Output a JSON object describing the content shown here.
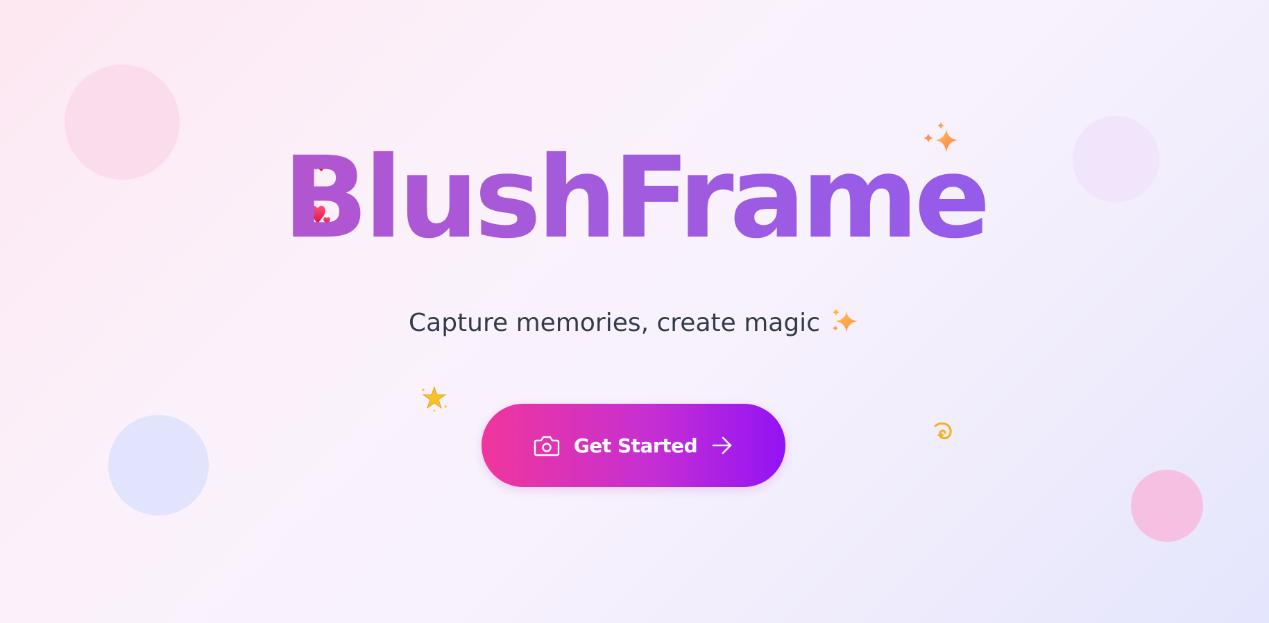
{
  "brand": {
    "title": "BlushFrame",
    "gradient": [
      "#c34fc4",
      "#8a5cf5"
    ]
  },
  "hero": {
    "tagline": "Capture memories, create magic"
  },
  "cta": {
    "label": "Get Started",
    "leading_icon": "camera-icon",
    "trailing_icon": "arrow-right-icon",
    "gradient": [
      "#f0369c",
      "#9313f4"
    ]
  },
  "decorations": {
    "icons": [
      "hearts-icon",
      "sparkles-icon",
      "glowing-star-icon",
      "dizzy-icon"
    ],
    "blob_colors": [
      "#fbdcec",
      "#f1e5fb",
      "#e2e3fd",
      "#f5c0e2"
    ]
  },
  "theme": {
    "text_color": "#333b4a",
    "background": [
      "#fde7f1",
      "#e4e6fd"
    ]
  }
}
